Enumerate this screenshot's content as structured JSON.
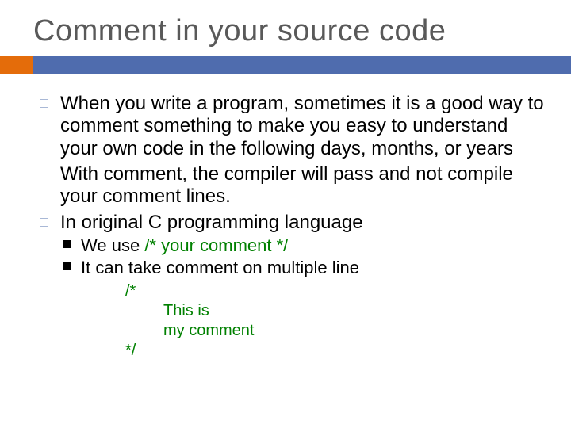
{
  "title": "Comment in your source code",
  "bullets": {
    "b1": "When you write a program, sometimes it is a good way to comment something to make you easy to understand your own code in the following days, months, or years",
    "b2": "With comment, the compiler will pass and not compile your comment lines.",
    "b3": "In original C programming language",
    "s1a": "We use ",
    "s1b": "/*  your comment  */",
    "s2": "It can take comment on multiple line"
  },
  "code": {
    "l1": "/*",
    "l2": "This is",
    "l3": "my comment",
    "l4": "*/"
  }
}
